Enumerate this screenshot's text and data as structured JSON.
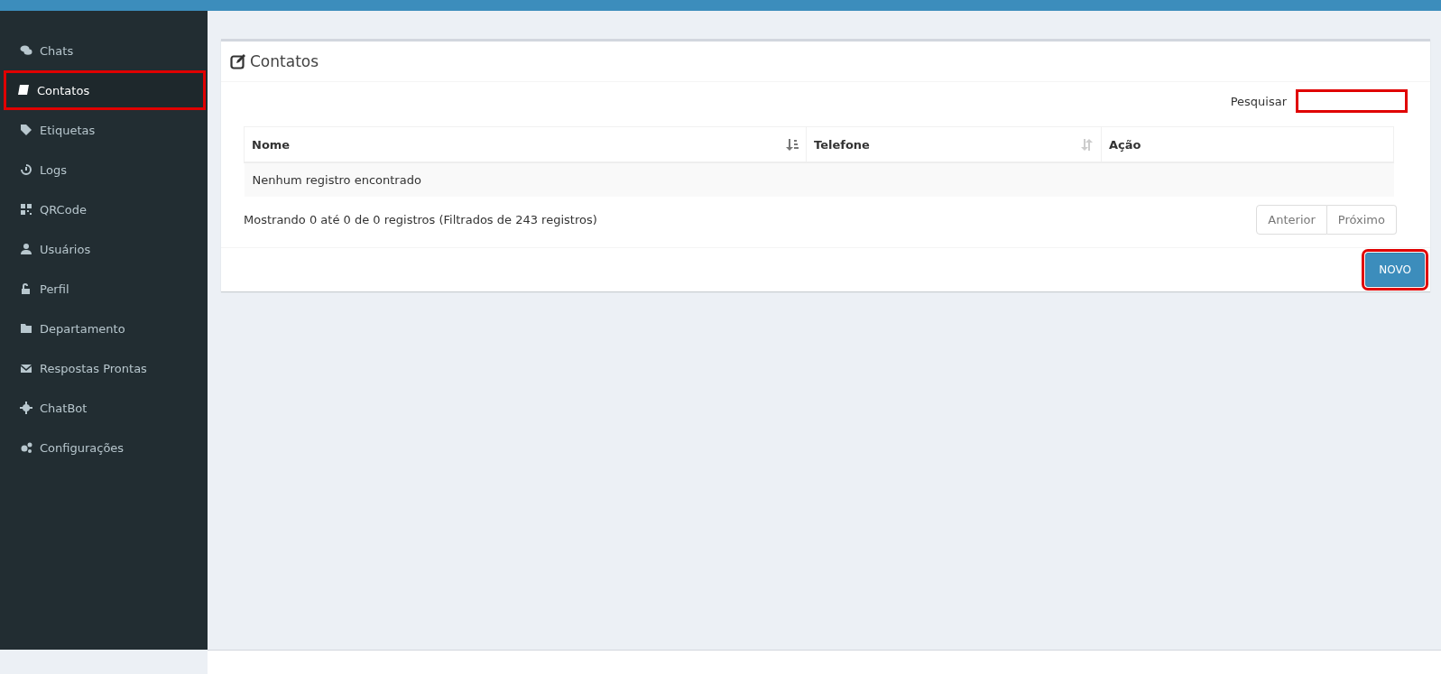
{
  "sidebar": {
    "items": [
      {
        "label": "Chats",
        "selected": false,
        "highlighted": false
      },
      {
        "label": "Contatos",
        "selected": true,
        "highlighted": true
      },
      {
        "label": "Etiquetas",
        "selected": false,
        "highlighted": false
      },
      {
        "label": "Logs",
        "selected": false,
        "highlighted": false
      },
      {
        "label": "QRCode",
        "selected": false,
        "highlighted": false
      },
      {
        "label": "Usuários",
        "selected": false,
        "highlighted": false
      },
      {
        "label": "Perfil",
        "selected": false,
        "highlighted": false
      },
      {
        "label": "Departamento",
        "selected": false,
        "highlighted": false
      },
      {
        "label": "Respostas Prontas",
        "selected": false,
        "highlighted": false
      },
      {
        "label": "ChatBot",
        "selected": false,
        "highlighted": false
      },
      {
        "label": "Configurações",
        "selected": false,
        "highlighted": false
      }
    ]
  },
  "panel": {
    "title": "Contatos",
    "search": {
      "label": "Pesquisar",
      "highlighted": true
    },
    "table": {
      "columns": [
        {
          "label": "Nome",
          "sortable": true,
          "sorted": true
        },
        {
          "label": "Telefone",
          "sortable": true,
          "sorted": false
        },
        {
          "label": "Ação",
          "sortable": false
        }
      ],
      "empty_message": "Nenhum registro encontrado"
    },
    "info": "Mostrando 0 até 0 de 0 registros (Filtrados de 243 registros)",
    "pagination": [
      {
        "label": "Anterior",
        "disabled": true
      },
      {
        "label": "Próximo",
        "disabled": true
      }
    ],
    "new_button": {
      "label": "NOVO",
      "highlighted": true
    }
  }
}
